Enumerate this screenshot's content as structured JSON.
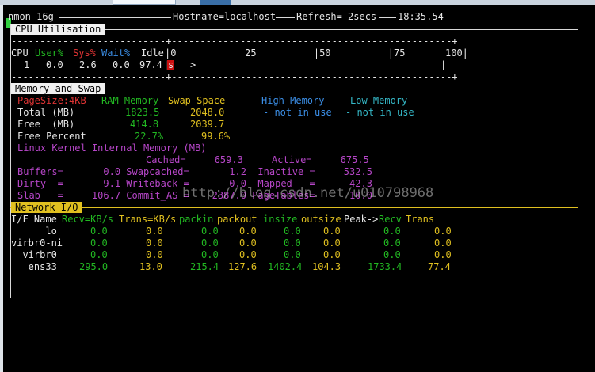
{
  "title_bar": {
    "left": "nmon-16g",
    "hostname": "Hostname=localhost",
    "refresh": "Refresh= 2secs",
    "time": "18:35.54"
  },
  "cpu": {
    "section": "CPU Utilisation",
    "dashes": "---------------------------+-------------------------------------------------+",
    "h_cpu": "CPU",
    "h_user": "User%",
    "h_sys": "Sys%",
    "h_wait": "Wait%",
    "h_idle": "Idle",
    "scale": "|0           |25          |50          |75       100|",
    "row_cpu": "1",
    "row_user": "0.0",
    "row_sys": "2.6",
    "row_wait": "0.0",
    "row_idle": "97.4",
    "bar_char": "s",
    "bar_arrow": ">",
    "bar_end": "|",
    "dashes2": "---------------------------+-------------------------------------------------+"
  },
  "memory": {
    "section": "Memory and Swap",
    "pagesize": "PageSize:4KB",
    "ram": "RAM-Memory",
    "swap": "Swap-Space",
    "high": "High-Memory",
    "low": "Low-Memory",
    "total_label": "Total (MB)",
    "total_ram": "1823.5",
    "total_swap": "2048.0",
    "total_high": "- not in use",
    "total_low": "- not in use",
    "free_label": "Free  (MB)",
    "free_ram": "414.8",
    "free_swap": "2039.7",
    "freepct_label": "Free Percent",
    "freepct_ram": "22.7%",
    "freepct_swap": "99.6%",
    "kernel_title": "Linux Kernel Internal Memory (MB)",
    "k_cached": "Cached=     659.3     Active=     675.5",
    "k_buffers": "Buffers=       0.0 Swapcached=       1.2  Inactive =     532.5",
    "k_dirty": "Dirty  =       9.1 Writeback =       0.0  Mapped   =      42.3",
    "k_slab": "Slab   =     106.7 Commit_AS =    2387.0 PageTables=      10.0"
  },
  "watermark": "http://blog.csdn.net/u010798968",
  "network": {
    "section": "Network I/O",
    "h_if": "I/F Name",
    "h_recv": "Recv=KB/s",
    "h_trans": "Trans=KB/s",
    "h_packin": "packin",
    "h_packout": "packout",
    "h_insize": "insize",
    "h_outsize": "outsize",
    "h_peak": "Peak->",
    "h_precv": "Recv",
    "h_ptrans": "Trans",
    "rows": [
      {
        "name": "      lo",
        "recv": "0.0",
        "trans": "0.0",
        "packin": "0.0",
        "packout": "0.0",
        "insize": "0.0",
        "outsize": "0.0",
        "peakrecv": "0.0",
        "peaktrans": "0.0"
      },
      {
        "name": "virbr0-ni",
        "recv": "0.0",
        "trans": "0.0",
        "packin": "0.0",
        "packout": "0.0",
        "insize": "0.0",
        "outsize": "0.0",
        "peakrecv": "0.0",
        "peaktrans": "0.0"
      },
      {
        "name": "  virbr0",
        "recv": "0.0",
        "trans": "0.0",
        "packin": "0.0",
        "packout": "0.0",
        "insize": "0.0",
        "outsize": "0.0",
        "peakrecv": "0.0",
        "peaktrans": "0.0"
      },
      {
        "name": "   ens33",
        "recv": "295.0",
        "trans": "13.0",
        "packin": "215.4",
        "packout": "127.6",
        "insize": "1402.4",
        "outsize": "104.3",
        "peakrecv": "1733.4",
        "peaktrans": "77.4"
      }
    ]
  }
}
